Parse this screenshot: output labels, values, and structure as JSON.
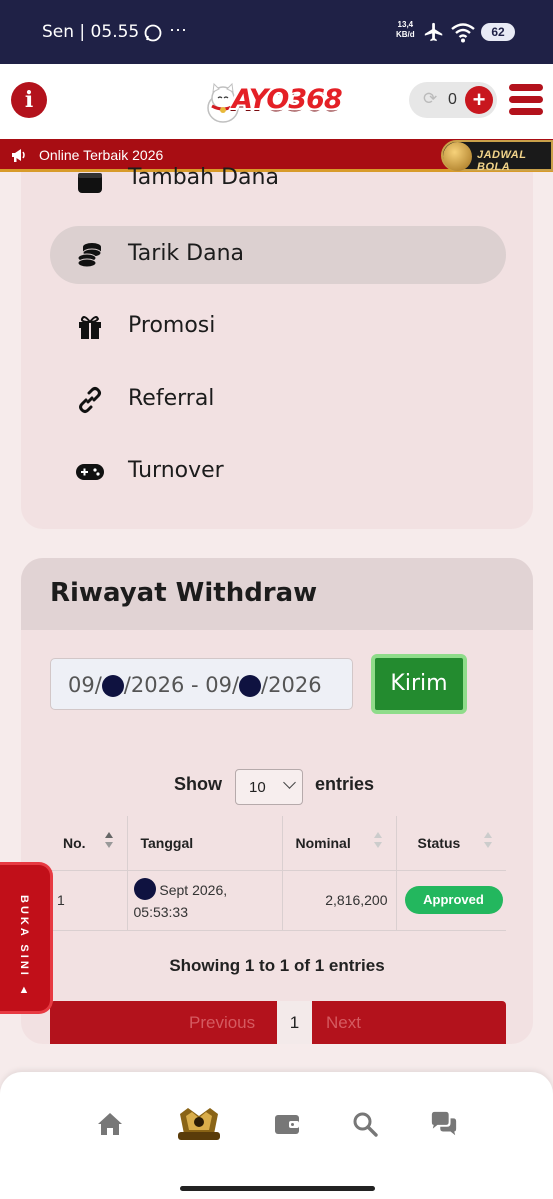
{
  "status_bar": {
    "time": "Sen | 05.55",
    "more": "⋯",
    "net_speed_value": "13,4",
    "net_speed_unit": "KB/d",
    "battery": "62"
  },
  "header": {
    "logo_text": "AYO368",
    "balance": "0",
    "brand_color": "#b3121c"
  },
  "marquee": {
    "text": "Online Terbaik 2026",
    "jadwal_label": "JADWAL BOLA"
  },
  "menu": {
    "items": [
      {
        "label": "Tambah Dana",
        "icon": "wallet-icon",
        "active": false
      },
      {
        "label": "Tarik Dana",
        "icon": "coins-icon",
        "active": true
      },
      {
        "label": "Promosi",
        "icon": "gift-icon",
        "active": false
      },
      {
        "label": "Referral",
        "icon": "link-icon",
        "active": false
      },
      {
        "label": "Turnover",
        "icon": "gamepad-icon",
        "active": false
      }
    ]
  },
  "riwayat": {
    "title": "Riwayat Withdraw",
    "date_start_prefix": "09/",
    "date_mid": "/2026 - 09/",
    "date_end_suffix": "/2026",
    "submit_label": "Kirim",
    "show_label": "Show",
    "entries_value": "10",
    "entries_label": "entries",
    "table": {
      "headers": [
        "No.",
        "Tanggal",
        "Nominal",
        "Status"
      ],
      "rows": [
        {
          "no": "1",
          "date_line1": "Sept 2026,",
          "date_line2": "05:53:33",
          "nominal": "2,816,200",
          "status": "Approved"
        }
      ]
    },
    "summary": "Showing 1 to 1 of 1 entries",
    "pagination": {
      "previous": "Previous",
      "current": "1",
      "next": "Next"
    }
  },
  "side_tab": {
    "label": "BUKA SINI ▲"
  },
  "bottom_nav": {
    "items": [
      "home-icon",
      "logo-icon",
      "wallet-icon",
      "search-icon",
      "chat-icon"
    ]
  }
}
